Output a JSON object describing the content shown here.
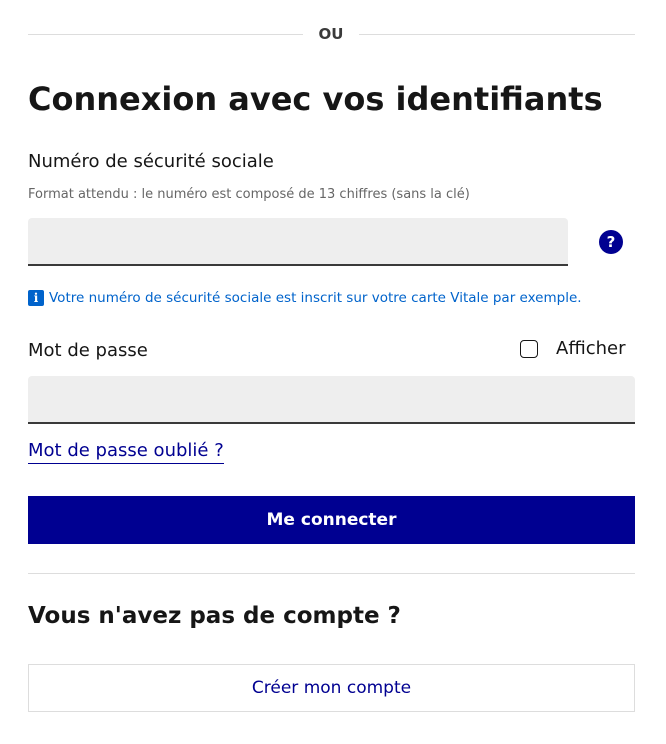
{
  "separator": {
    "text": "OU"
  },
  "title": "Connexion avec vos identifiants",
  "nss_field": {
    "label": "Numéro de sécurité sociale",
    "hint": "Format attendu : le numéro est composé de 13 chiffres (sans la clé)",
    "value": "",
    "placeholder": "",
    "help_icon": "?",
    "info_icon": "i",
    "info_text": "Votre numéro de sécurité sociale est inscrit sur votre carte Vitale par exemple."
  },
  "password_field": {
    "label": "Mot de passe",
    "show_label": "Afficher",
    "show_checked": false,
    "value": "",
    "placeholder": ""
  },
  "forgot_password_link": "Mot de passe oublié ?",
  "login_button": "Me connecter",
  "no_account": {
    "title": "Vous n'avez pas de compte ?",
    "create_button": "Créer mon compte"
  },
  "colors": {
    "primary": "#000091",
    "info": "#0063cb",
    "input_background": "#eeeeee",
    "divider": "#dddddd",
    "text": "#161616"
  },
  "icons": {
    "help": "question-circle-icon",
    "info": "info-square-icon",
    "checkbox": "checkbox-unchecked-icon"
  }
}
